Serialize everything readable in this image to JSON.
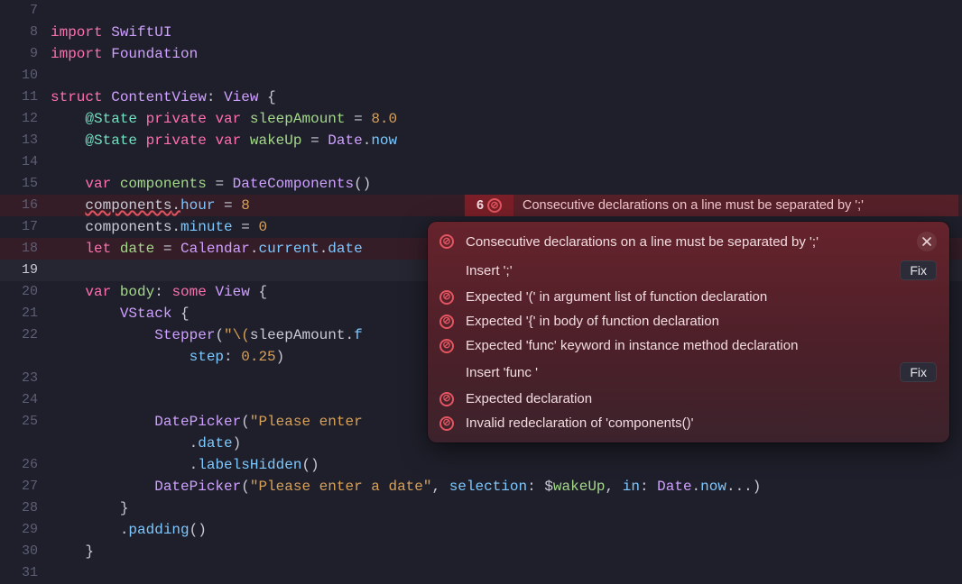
{
  "lines": {
    "7": {
      "num": "7"
    },
    "8": {
      "num": "8",
      "import": "import",
      "mod": "SwiftUI"
    },
    "9": {
      "num": "9",
      "import": "import",
      "mod": "Foundation"
    },
    "10": {
      "num": "10"
    },
    "11": {
      "num": "11",
      "struct": "struct",
      "name": "ContentView",
      "colon": ":",
      "proto": "View",
      "brace": " {"
    },
    "12": {
      "num": "12",
      "atstate": "@State",
      "private": "private",
      "var": "var",
      "name": "sleepAmount",
      "eq": " = ",
      "val": "8.0"
    },
    "13": {
      "num": "13",
      "atstate": "@State",
      "private": "private",
      "var": "var",
      "name": "wakeUp",
      "eq": " = ",
      "datekw": "Date",
      "dot": ".",
      "now": "now"
    },
    "14": {
      "num": "14"
    },
    "15": {
      "num": "15",
      "var": "var",
      "name": "components",
      "eq": " = ",
      "type": "DateComponents",
      "parens": "()"
    },
    "16": {
      "num": "16",
      "obj": "components",
      "dot": ".",
      "prop": "hour",
      "eq": " = ",
      "val": "8"
    },
    "17": {
      "num": "17",
      "obj": "components",
      "dot": ".",
      "prop": "minute",
      "eq": " = ",
      "val": "0"
    },
    "18": {
      "num": "18",
      "let": "let",
      "name": "date",
      "eq": " = ",
      "type": "Calendar",
      "dot": ".",
      "current": "current",
      "dot2": ".",
      "datefn": "date"
    },
    "19": {
      "num": "19"
    },
    "20": {
      "num": "20",
      "var": "var",
      "name": "body",
      "colon": ": ",
      "some": "some",
      "view": " View",
      "brace": " {"
    },
    "21": {
      "num": "21",
      "vstack": "VStack",
      "brace": " {"
    },
    "22": {
      "num": "22",
      "stepper": "Stepper",
      "open": "(",
      "q1": "\"",
      "interp_open": "\\(",
      "arg": "sleepAmount",
      "dot": ".",
      "fmt_prefix": "f"
    },
    "22b": {
      "step_label": "step",
      "colon": ": ",
      "val": "0.25",
      "close": ")"
    },
    "23": {
      "num": "23"
    },
    "24": {
      "num": "24"
    },
    "25": {
      "num": "25",
      "dp": "DatePicker",
      "open": "(",
      "str": "\"Please enter"
    },
    "25b": {
      "dot": ".",
      "date": "date",
      "close": ")"
    },
    "26": {
      "num": "26",
      "dot": ".",
      "fn": "labelsHidden",
      "parens": "()"
    },
    "27": {
      "num": "27",
      "dp": "DatePicker",
      "open": "(",
      "str": "\"Please enter a date\"",
      "comma": ", ",
      "sel_label": "selection",
      "colon": ": ",
      "dollar": "$",
      "wake": "wakeUp",
      "comma2": ", ",
      "in_label": "in",
      "colon2": ": ",
      "datekw": "Date",
      "dot": ".",
      "now": "now",
      "ell": "...",
      "close": ")"
    },
    "28": {
      "num": "28",
      "brace": "}"
    },
    "29": {
      "num": "29",
      "dot": ".",
      "fn": "padding",
      "parens": "()"
    },
    "30": {
      "num": "30",
      "brace": "}"
    },
    "31": {
      "num": "31"
    }
  },
  "inline_banner": {
    "count": "6",
    "message": "Consecutive declarations on a line must be separated by ';'"
  },
  "popup": {
    "items": [
      {
        "kind": "error",
        "text": "Consecutive declarations on a line must be separated by ';'",
        "close": true
      },
      {
        "kind": "fix",
        "text": "Insert ';'",
        "fix_label": "Fix"
      },
      {
        "kind": "error",
        "text": "Expected '(' in argument list of function declaration"
      },
      {
        "kind": "error",
        "text": "Expected '{' in body of function declaration"
      },
      {
        "kind": "error",
        "text": "Expected 'func' keyword in instance method declaration"
      },
      {
        "kind": "fix",
        "text": "Insert 'func '",
        "fix_label": "Fix"
      },
      {
        "kind": "error",
        "text": "Expected declaration"
      },
      {
        "kind": "error",
        "text": "Invalid redeclaration of 'components()'"
      }
    ]
  }
}
